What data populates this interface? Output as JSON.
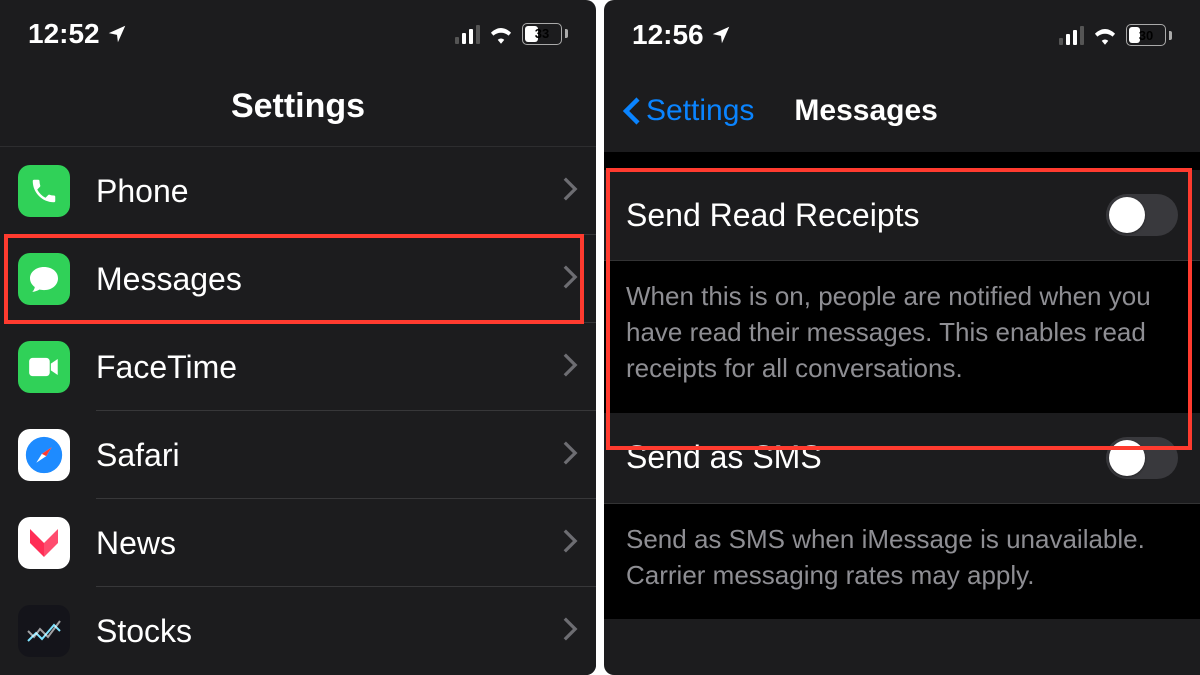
{
  "left": {
    "status": {
      "time": "12:52",
      "battery_pct": "33"
    },
    "title": "Settings",
    "items": [
      {
        "label": "Phone"
      },
      {
        "label": "Messages"
      },
      {
        "label": "FaceTime"
      },
      {
        "label": "Safari"
      },
      {
        "label": "News"
      },
      {
        "label": "Stocks"
      }
    ]
  },
  "right": {
    "status": {
      "time": "12:56",
      "battery_pct": "30"
    },
    "back_label": "Settings",
    "title": "Messages",
    "rows": [
      {
        "label": "Send Read Receipts",
        "desc": "When this is on, people are notified when you have read their messages. This enables read receipts for all conversations."
      },
      {
        "label": "Send as SMS",
        "desc": "Send as SMS when iMessage is unavailable. Carrier messaging rates may apply."
      }
    ]
  }
}
